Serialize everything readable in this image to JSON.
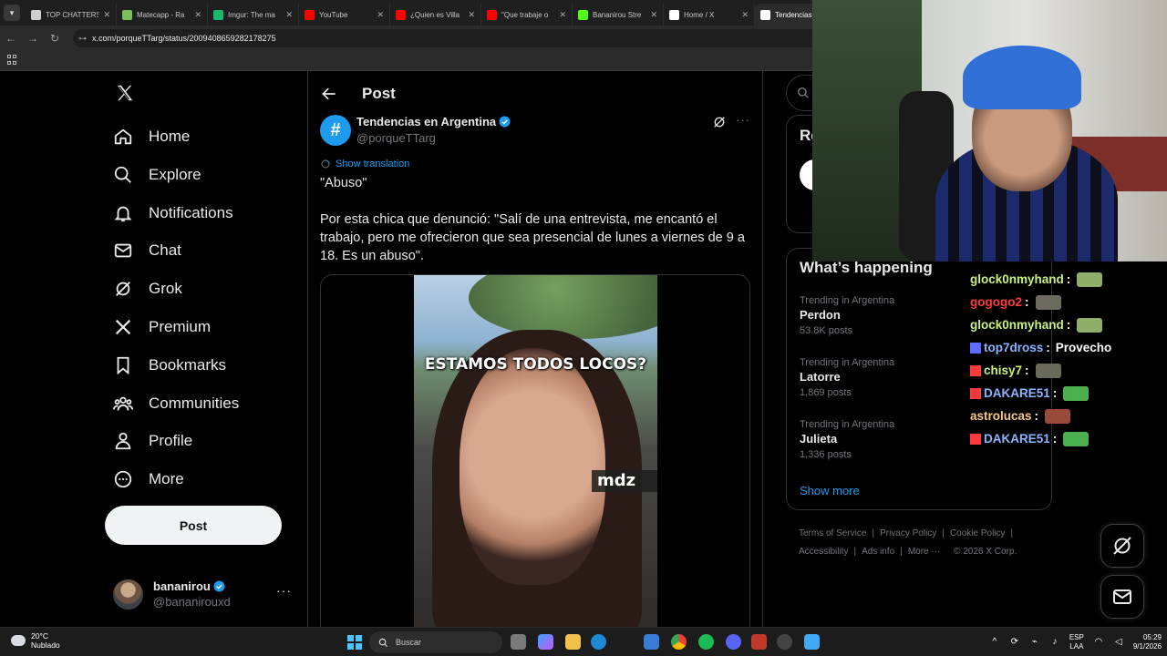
{
  "browser": {
    "tabs": [
      {
        "title": "TOP CHATTERS",
        "color": "#d0d0d0"
      },
      {
        "title": "Matecapp - Ra",
        "color": "#7bbf5a"
      },
      {
        "title": "Imgur: The ma",
        "color": "#1bb76e"
      },
      {
        "title": "YouTube",
        "color": "#ff0000"
      },
      {
        "title": "¿Quien es Villa",
        "color": "#ff0000"
      },
      {
        "title": "\"Que trabaje o",
        "color": "#ff0000"
      },
      {
        "title": "Bananirou Stre",
        "color": "#53fc18"
      },
      {
        "title": "Home / X",
        "color": "#ffffff"
      },
      {
        "title": "Tendencias",
        "color": "#ffffff"
      }
    ],
    "url": "x.com/porqueTTarg/status/2009408659282178275"
  },
  "nav": {
    "items": [
      {
        "label": "Home",
        "icon": "home-icon"
      },
      {
        "label": "Explore",
        "icon": "search-icon"
      },
      {
        "label": "Notifications",
        "icon": "bell-icon"
      },
      {
        "label": "Chat",
        "icon": "mail-icon"
      },
      {
        "label": "Grok",
        "icon": "grok-icon"
      },
      {
        "label": "Premium",
        "icon": "x-logo-icon"
      },
      {
        "label": "Bookmarks",
        "icon": "bookmark-icon"
      },
      {
        "label": "Communities",
        "icon": "communities-icon"
      },
      {
        "label": "Profile",
        "icon": "person-icon"
      },
      {
        "label": "More",
        "icon": "more-circle-icon"
      }
    ],
    "post_label": "Post",
    "account": {
      "name": "bananirou",
      "handle": "@bananirouxd"
    }
  },
  "main": {
    "title": "Post",
    "author": {
      "name": "Tendencias en Argentina",
      "handle": "@porqueTTarg",
      "avatar_symbol": "#"
    },
    "translate_label": "Show translation",
    "text": [
      "\"Abuso\"",
      "Por esta chica que denunció: \"Salí de una entrevista, me encantó el trabajo, pero me ofrecieron que sea presencial de lunes a viernes de 9 a 18. Es un abuso\"."
    ],
    "video_caption": "ESTAMOS TODOS LOCOS?",
    "video_watermark": "mdz"
  },
  "right": {
    "premium_title_partial": "Re",
    "happening_title": "What’s happening",
    "trends": [
      {
        "context": "Trending in Argentina",
        "title": "Perdon",
        "count": "53.8K posts"
      },
      {
        "context": "Trending in Argentina",
        "title": "Latorre",
        "count": "1,869 posts"
      },
      {
        "context": "Trending in Argentina",
        "title": "Julieta",
        "count": "1,336 posts"
      }
    ],
    "show_more": "Show more",
    "footer": [
      "Terms of Service",
      "Privacy Policy",
      "Cookie Policy",
      "Accessibility",
      "Ads info",
      "More ···",
      "© 2026 X Corp."
    ]
  },
  "chat": [
    {
      "user": "glock0nmyhand",
      "color": "#c9f27a",
      "msg": "",
      "emote": "#8fae6a",
      "badge": ""
    },
    {
      "user": "gogogo2",
      "color": "#ff3b3b",
      "msg": "",
      "emote": "#6d6b5e",
      "badge": ""
    },
    {
      "user": "glock0nmyhand",
      "color": "#c9f27a",
      "msg": "",
      "emote": "#8fae6a",
      "badge": ""
    },
    {
      "user": "top7dross",
      "color": "#8ab4ff",
      "msg": "Provecho",
      "emote": "",
      "badge": "#5b6cff"
    },
    {
      "user": "chisy7",
      "color": "#c9f27a",
      "msg": "",
      "emote": "#6b6a5a",
      "badge": "#ff3b3b"
    },
    {
      "user": "DAKARE51",
      "color": "#8ab4ff",
      "msg": "",
      "emote": "#4caf50",
      "badge": "#ff3b3b"
    },
    {
      "user": "astrolucas",
      "color": "#f7c97b",
      "msg": "",
      "emote": "#9a4a3c",
      "badge": ""
    },
    {
      "user": "DAKARE51",
      "color": "#8ab4ff",
      "msg": "",
      "emote": "#4caf50",
      "badge": "#ff3b3b"
    }
  ],
  "taskbar": {
    "temp": "20°C",
    "weather": "Nublado",
    "search": "Buscar",
    "lang_top": "ESP",
    "lang_bottom": "LAA",
    "time": "05:29",
    "date": "9/1/2026"
  },
  "colors": {
    "accent": "#1d9bf0",
    "background": "#000000",
    "border": "#2f3336"
  }
}
